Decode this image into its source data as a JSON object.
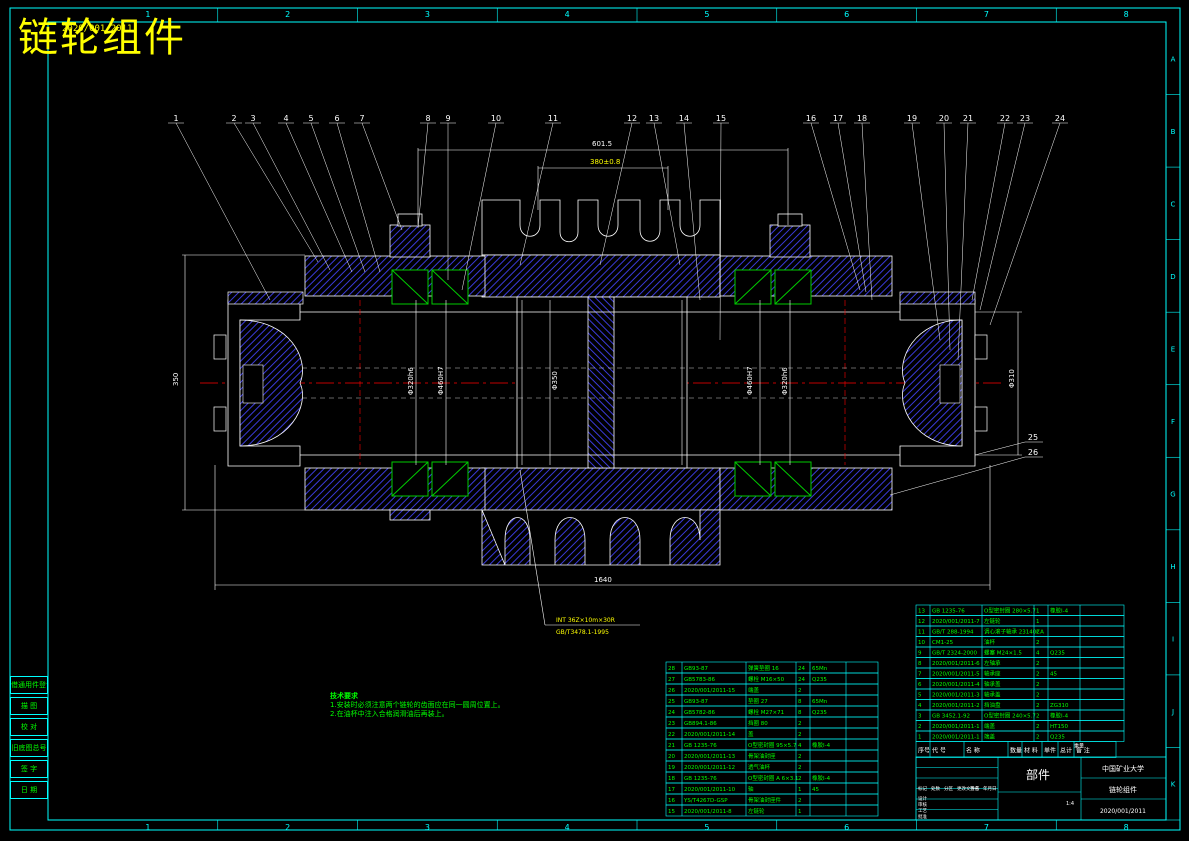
{
  "drawing": {
    "title": "链轮组件",
    "drawing_number_small": "2020/001/2011",
    "grid_columns": [
      "1",
      "2",
      "3",
      "4",
      "5",
      "6",
      "7",
      "8"
    ],
    "grid_rows": [
      "A",
      "B",
      "C",
      "D",
      "E",
      "F",
      "G",
      "H",
      "I",
      "J",
      "K"
    ],
    "balloons": [
      "1",
      "2",
      "3",
      "4",
      "5",
      "6",
      "7",
      "8",
      "9",
      "10",
      "11",
      "12",
      "13",
      "14",
      "15",
      "16",
      "17",
      "18",
      "19",
      "20",
      "21",
      "22",
      "23",
      "24",
      "25",
      "26"
    ],
    "dimensions": {
      "top_outer": "601.5",
      "top_inner": "380±0.8",
      "height_left": "350",
      "overall_length": "1640",
      "right_dia": "Φ310",
      "bearing_left_1": "Φ320h6",
      "bearing_left_2": "Φ460H7",
      "center": "Φ350",
      "bearing_right_1": "Φ460H7",
      "bearing_right_2": "Φ320h6"
    },
    "spline_note_1": "INT 36Z×10m×30R",
    "spline_note_2": "GB/T3478.1-1995",
    "tech_req_title": "技术要求",
    "tech_req_1": "1.安装时必须注意两个链轮的齿面应在同一圆周位置上。",
    "tech_req_2": "2.在油杯中注入合格润滑油后再装上。"
  },
  "side_table": [
    "借通用件登记",
    "描 图",
    "校 对",
    "旧底图总号",
    "签 字",
    "日 期"
  ],
  "bom_left": [
    [
      "28",
      "GB93-87",
      "弹簧垫圈 16",
      "24",
      "65Mn",
      ""
    ],
    [
      "27",
      "GB5783-86",
      "螺栓 M16×50",
      "24",
      "Q235",
      ""
    ],
    [
      "26",
      "2020/001/2011-15",
      "端盖",
      "2",
      "",
      ""
    ],
    [
      "25",
      "GB93-87",
      "垫圈 27",
      "8",
      "65Mn",
      ""
    ],
    [
      "24",
      "GB5782-86",
      "螺栓 M27×71",
      "8",
      "Q235",
      ""
    ],
    [
      "23",
      "GB894.1-86",
      "挡圈 80",
      "2",
      "",
      ""
    ],
    [
      "22",
      "2020/001/2011-14",
      "盖",
      "2",
      "",
      ""
    ],
    [
      "21",
      "GB 1235-76",
      "O型密封圈 95×5.7",
      "4",
      "橡胶I-4",
      ""
    ],
    [
      "20",
      "2020/001/2011-13",
      "骨架油封座",
      "2",
      "",
      ""
    ],
    [
      "19",
      "2020/001/2011-12",
      "透气油杯",
      "2",
      "",
      ""
    ],
    [
      "18",
      "GB 1235-76",
      "O型密封圈 A 6×3.1",
      "2",
      "橡胶I-4",
      ""
    ],
    [
      "17",
      "2020/001/2011-10",
      "轴",
      "1",
      "45",
      ""
    ],
    [
      "16",
      "YS/T4267D-GSP",
      "骨架油封座件",
      "2",
      "",
      ""
    ],
    [
      "15",
      "2020/001/2011-8",
      "左链轮",
      "1",
      "",
      ""
    ]
  ],
  "bom_right": [
    [
      "13",
      "GB 1235-76",
      "O型密封圈 280×5.7",
      "1",
      "橡胶I-4",
      ""
    ],
    [
      "12",
      "2020/001/2011-7",
      "左链轮",
      "1",
      "",
      ""
    ],
    [
      "11",
      "GB/T 288-1994",
      "调心滚子轴承 23140CA",
      "2",
      "",
      ""
    ],
    [
      "10",
      "CM1-25",
      "油杯",
      "2",
      "",
      ""
    ],
    [
      "9",
      "GB/T 2324-2000",
      "螺塞 M24×1.5",
      "4",
      "Q235",
      ""
    ],
    [
      "8",
      "2020/001/2011-6",
      "左轴承",
      "2",
      "",
      ""
    ],
    [
      "7",
      "2020/001/2011-5",
      "轴承座",
      "2",
      "45",
      ""
    ],
    [
      "6",
      "2020/001/2011-4",
      "轴承盖",
      "2",
      "",
      ""
    ],
    [
      "5",
      "2020/001/2011-3",
      "轴承盖",
      "2",
      "",
      ""
    ],
    [
      "4",
      "2020/001/2011-2",
      "挡油盘",
      "2",
      "ZG310",
      ""
    ],
    [
      "3",
      "GB 3452.1-92",
      "O型密封圈 240×5.7",
      "2",
      "橡胶I-4",
      ""
    ],
    [
      "2",
      "2020/001/2011-1",
      "端盖",
      "2",
      "HT150",
      ""
    ],
    [
      "1",
      "2020/001/2011-1",
      "端盖",
      "2",
      "Q235",
      ""
    ]
  ],
  "bom_header": [
    "序号",
    "代 号",
    "名 称",
    "数量",
    "材 料",
    "单件",
    "总计",
    "备 注"
  ],
  "bom_header_weight": "重量",
  "title_block": {
    "part_label": "部件",
    "school": "中国矿业大学",
    "name": "链轮组件",
    "number": "2020/001/2011",
    "scale": "1:4",
    "rows": [
      "标记",
      "处数",
      "分区",
      "更改文件号",
      "签名",
      "年月日"
    ],
    "roles": [
      "设计",
      "审核",
      "工艺",
      "批准"
    ]
  },
  "colors": {
    "frame": "#00ffff",
    "text_yellow": "#ffff00",
    "text_green": "#00ff00",
    "hatch": "#3333cc",
    "center_line": "#ff0000",
    "part_outline": "#ffffff",
    "bearing": "#00cc00"
  }
}
